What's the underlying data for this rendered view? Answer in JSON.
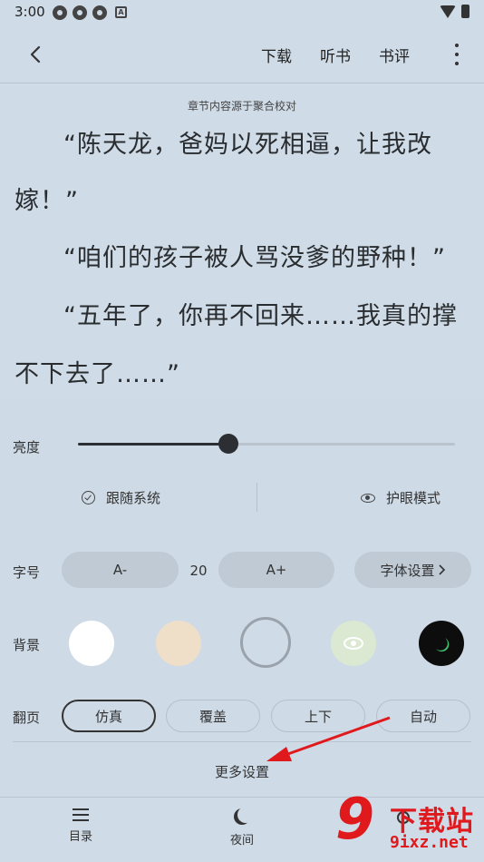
{
  "status_bar": {
    "time": "3:00"
  },
  "toolbar": {
    "download": "下载",
    "listen": "听书",
    "review": "书评"
  },
  "reader": {
    "source_note": "章节内容源于聚合校对",
    "lines": [
      "“陈天龙，爸妈以死相逼，让我改",
      "嫁！”",
      "“咱们的孩子被人骂没爹的野种！”",
      "“五年了，你再不回来……我真的撑",
      "不下去了……”"
    ]
  },
  "brightness": {
    "label": "亮度",
    "level": 0.4
  },
  "options": {
    "follow_system": "跟随系统",
    "eye_care": "护眼模式"
  },
  "font_size": {
    "label": "字号",
    "decrease": "A-",
    "value": "20",
    "increase": "A+",
    "font_settings": "字体设置"
  },
  "background": {
    "label": "背景",
    "colors": [
      "#ffffff",
      "#f0dfc8",
      "#cfdbe7",
      "#dbe9d3",
      "#0d0d0d"
    ],
    "selected_index": 2
  },
  "page_turn": {
    "label": "翻页",
    "options": [
      "仿真",
      "覆盖",
      "上下",
      "自动"
    ],
    "selected": "仿真"
  },
  "more_settings": "更多设置",
  "bottom_nav": {
    "toc": "目录",
    "night": "夜间"
  },
  "watermark": {
    "main": "下载站",
    "number": "9",
    "sub": "9ixz.net"
  },
  "colors": {
    "accent_arrow": "#e0191d",
    "panel_bg": "#cedae6"
  }
}
